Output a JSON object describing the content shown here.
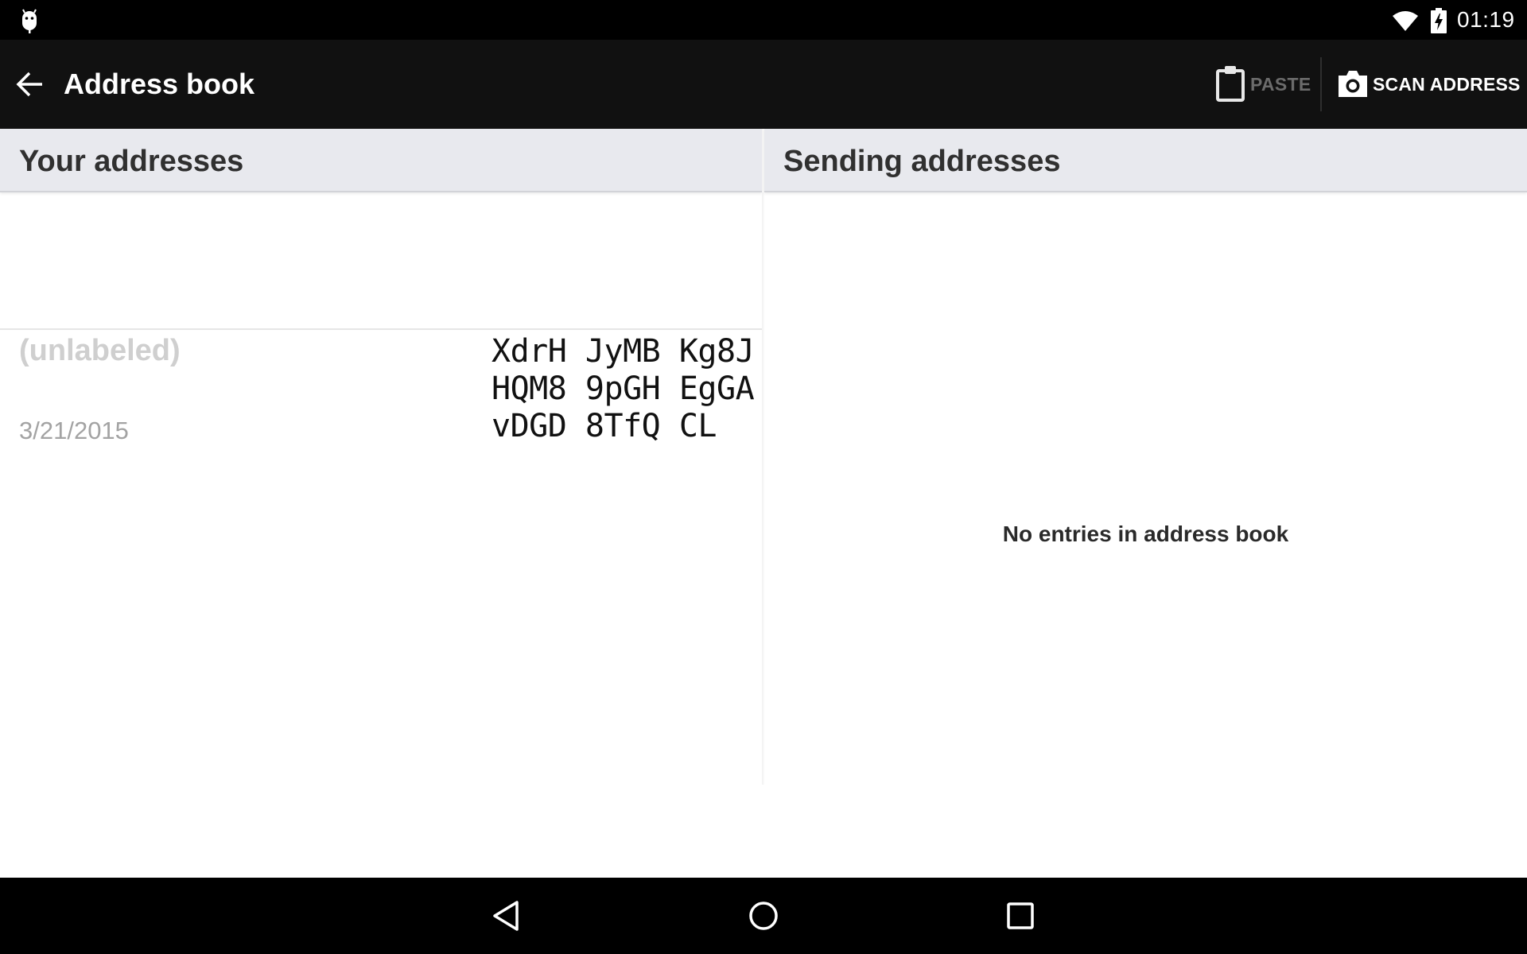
{
  "status_bar": {
    "time": "01:19",
    "icons": [
      "android-icon",
      "wifi-icon",
      "battery-charging-icon"
    ]
  },
  "action_bar": {
    "title": "Address book",
    "back_icon": "arrow-back-icon",
    "paste": {
      "label": "PASTE",
      "icon": "clipboard-icon",
      "enabled": false
    },
    "scan": {
      "label": "SCAN ADDRESS",
      "icon": "camera-icon"
    }
  },
  "your_addresses": {
    "header": "Your addresses",
    "items": [
      {
        "label": "(unlabeled)",
        "date": "3/21/2015",
        "address_lines": [
          "XdrH JyMB Kg8J",
          "HQM8 9pGH EgGA",
          "vDGD 8TfQ CL"
        ]
      }
    ]
  },
  "sending_addresses": {
    "header": "Sending addresses",
    "empty_message": "No entries in address book"
  },
  "nav_bar": {
    "buttons": [
      "nav-back-icon",
      "nav-home-icon",
      "nav-recents-icon"
    ]
  },
  "colors": {
    "action_bar": "#111111",
    "section_header": "#e8e9ee",
    "disabled_text": "#6b6b6b"
  }
}
